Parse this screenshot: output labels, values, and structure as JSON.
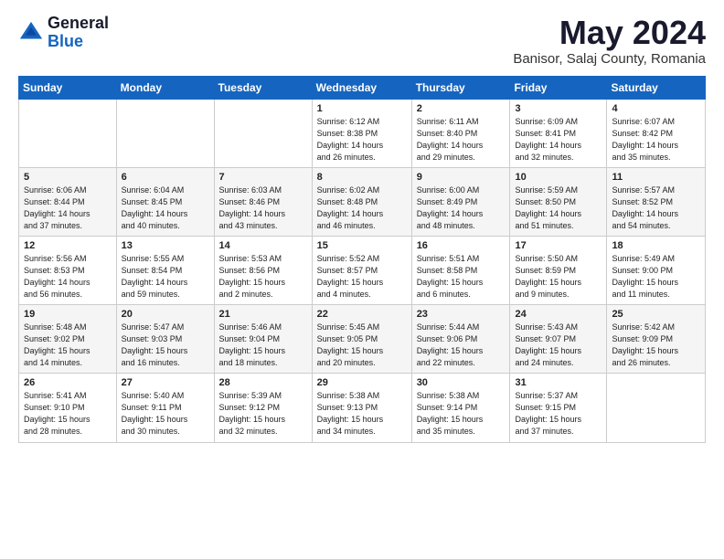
{
  "header": {
    "logo_general": "General",
    "logo_blue": "Blue",
    "month_title": "May 2024",
    "location": "Banisor, Salaj County, Romania"
  },
  "days_of_week": [
    "Sunday",
    "Monday",
    "Tuesday",
    "Wednesday",
    "Thursday",
    "Friday",
    "Saturday"
  ],
  "weeks": [
    [
      {
        "num": "",
        "info": ""
      },
      {
        "num": "",
        "info": ""
      },
      {
        "num": "",
        "info": ""
      },
      {
        "num": "1",
        "info": "Sunrise: 6:12 AM\nSunset: 8:38 PM\nDaylight: 14 hours\nand 26 minutes."
      },
      {
        "num": "2",
        "info": "Sunrise: 6:11 AM\nSunset: 8:40 PM\nDaylight: 14 hours\nand 29 minutes."
      },
      {
        "num": "3",
        "info": "Sunrise: 6:09 AM\nSunset: 8:41 PM\nDaylight: 14 hours\nand 32 minutes."
      },
      {
        "num": "4",
        "info": "Sunrise: 6:07 AM\nSunset: 8:42 PM\nDaylight: 14 hours\nand 35 minutes."
      }
    ],
    [
      {
        "num": "5",
        "info": "Sunrise: 6:06 AM\nSunset: 8:44 PM\nDaylight: 14 hours\nand 37 minutes."
      },
      {
        "num": "6",
        "info": "Sunrise: 6:04 AM\nSunset: 8:45 PM\nDaylight: 14 hours\nand 40 minutes."
      },
      {
        "num": "7",
        "info": "Sunrise: 6:03 AM\nSunset: 8:46 PM\nDaylight: 14 hours\nand 43 minutes."
      },
      {
        "num": "8",
        "info": "Sunrise: 6:02 AM\nSunset: 8:48 PM\nDaylight: 14 hours\nand 46 minutes."
      },
      {
        "num": "9",
        "info": "Sunrise: 6:00 AM\nSunset: 8:49 PM\nDaylight: 14 hours\nand 48 minutes."
      },
      {
        "num": "10",
        "info": "Sunrise: 5:59 AM\nSunset: 8:50 PM\nDaylight: 14 hours\nand 51 minutes."
      },
      {
        "num": "11",
        "info": "Sunrise: 5:57 AM\nSunset: 8:52 PM\nDaylight: 14 hours\nand 54 minutes."
      }
    ],
    [
      {
        "num": "12",
        "info": "Sunrise: 5:56 AM\nSunset: 8:53 PM\nDaylight: 14 hours\nand 56 minutes."
      },
      {
        "num": "13",
        "info": "Sunrise: 5:55 AM\nSunset: 8:54 PM\nDaylight: 14 hours\nand 59 minutes."
      },
      {
        "num": "14",
        "info": "Sunrise: 5:53 AM\nSunset: 8:56 PM\nDaylight: 15 hours\nand 2 minutes."
      },
      {
        "num": "15",
        "info": "Sunrise: 5:52 AM\nSunset: 8:57 PM\nDaylight: 15 hours\nand 4 minutes."
      },
      {
        "num": "16",
        "info": "Sunrise: 5:51 AM\nSunset: 8:58 PM\nDaylight: 15 hours\nand 6 minutes."
      },
      {
        "num": "17",
        "info": "Sunrise: 5:50 AM\nSunset: 8:59 PM\nDaylight: 15 hours\nand 9 minutes."
      },
      {
        "num": "18",
        "info": "Sunrise: 5:49 AM\nSunset: 9:00 PM\nDaylight: 15 hours\nand 11 minutes."
      }
    ],
    [
      {
        "num": "19",
        "info": "Sunrise: 5:48 AM\nSunset: 9:02 PM\nDaylight: 15 hours\nand 14 minutes."
      },
      {
        "num": "20",
        "info": "Sunrise: 5:47 AM\nSunset: 9:03 PM\nDaylight: 15 hours\nand 16 minutes."
      },
      {
        "num": "21",
        "info": "Sunrise: 5:46 AM\nSunset: 9:04 PM\nDaylight: 15 hours\nand 18 minutes."
      },
      {
        "num": "22",
        "info": "Sunrise: 5:45 AM\nSunset: 9:05 PM\nDaylight: 15 hours\nand 20 minutes."
      },
      {
        "num": "23",
        "info": "Sunrise: 5:44 AM\nSunset: 9:06 PM\nDaylight: 15 hours\nand 22 minutes."
      },
      {
        "num": "24",
        "info": "Sunrise: 5:43 AM\nSunset: 9:07 PM\nDaylight: 15 hours\nand 24 minutes."
      },
      {
        "num": "25",
        "info": "Sunrise: 5:42 AM\nSunset: 9:09 PM\nDaylight: 15 hours\nand 26 minutes."
      }
    ],
    [
      {
        "num": "26",
        "info": "Sunrise: 5:41 AM\nSunset: 9:10 PM\nDaylight: 15 hours\nand 28 minutes."
      },
      {
        "num": "27",
        "info": "Sunrise: 5:40 AM\nSunset: 9:11 PM\nDaylight: 15 hours\nand 30 minutes."
      },
      {
        "num": "28",
        "info": "Sunrise: 5:39 AM\nSunset: 9:12 PM\nDaylight: 15 hours\nand 32 minutes."
      },
      {
        "num": "29",
        "info": "Sunrise: 5:38 AM\nSunset: 9:13 PM\nDaylight: 15 hours\nand 34 minutes."
      },
      {
        "num": "30",
        "info": "Sunrise: 5:38 AM\nSunset: 9:14 PM\nDaylight: 15 hours\nand 35 minutes."
      },
      {
        "num": "31",
        "info": "Sunrise: 5:37 AM\nSunset: 9:15 PM\nDaylight: 15 hours\nand 37 minutes."
      },
      {
        "num": "",
        "info": ""
      }
    ]
  ]
}
